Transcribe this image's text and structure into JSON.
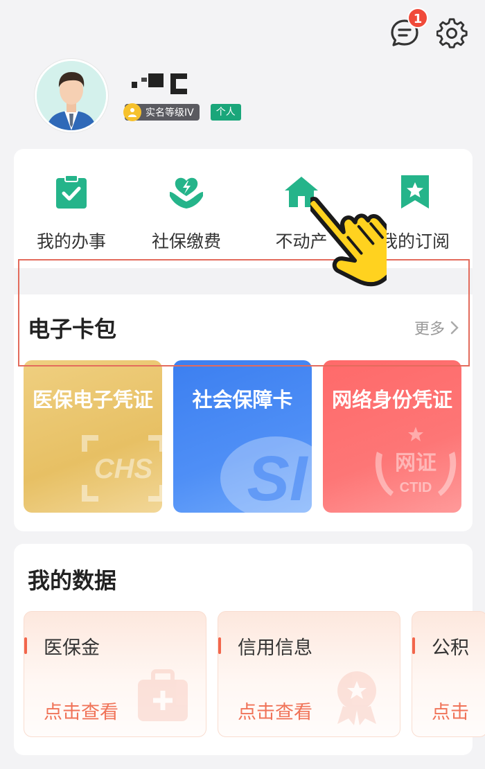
{
  "header": {
    "message_badge": "1",
    "icons": {
      "messages": "chat-bubble-icon",
      "settings": "gear-icon"
    }
  },
  "profile": {
    "level_badge": "实名等级IV",
    "type_badge": "个人"
  },
  "quick_actions": [
    {
      "label": "我的办事",
      "icon": "clipboard-check-icon"
    },
    {
      "label": "社保缴费",
      "icon": "hands-bolt-icon"
    },
    {
      "label": "不动产",
      "icon": "house-icon"
    },
    {
      "label": "我的订阅",
      "icon": "bookmark-star-icon"
    }
  ],
  "card_wallet": {
    "title": "电子卡包",
    "more": "更多",
    "cards": [
      {
        "title": "医保电子凭证",
        "color": "#e8c164"
      },
      {
        "title": "社会保障卡",
        "color": "#4586f3"
      },
      {
        "title": "网络身份凭证",
        "color": "#fe6f6f"
      }
    ]
  },
  "my_data": {
    "title": "我的数据",
    "items": [
      {
        "name": "医保金",
        "action": "点击查看"
      },
      {
        "name": "信用信息",
        "action": "点击查看"
      },
      {
        "name": "公积",
        "action": "点击"
      }
    ]
  },
  "colors": {
    "accent_green": "#1aa67a",
    "highlight_border": "#e36b5c",
    "action_orange": "#f07358"
  }
}
